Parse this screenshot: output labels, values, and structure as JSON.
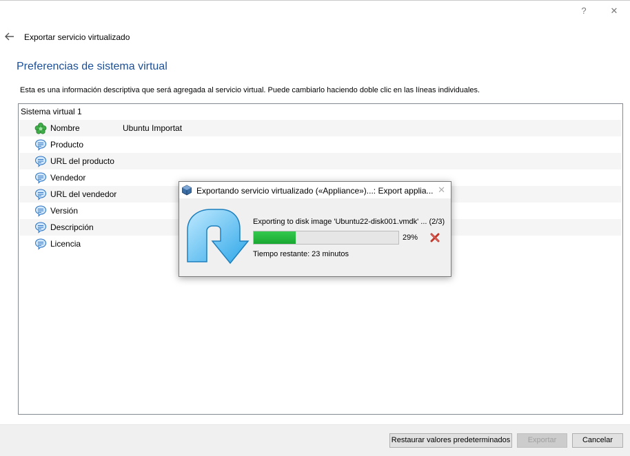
{
  "window": {
    "help_label": "?",
    "close_label": "✕"
  },
  "wizard": {
    "title": "Exportar servicio virtualizado",
    "heading": "Preferencias de sistema virtual",
    "description": "Esta es una información descriptiva que será agregada al servicio virtual. Puede cambiarlo haciendo doble clic en las líneas individuales."
  },
  "tree": {
    "root": "Sistema virtual 1",
    "rows": [
      {
        "label": "Nombre",
        "value": "Ubuntu Importat",
        "icon": "name-icon"
      },
      {
        "label": "Producto",
        "value": "",
        "icon": "description-icon"
      },
      {
        "label": "URL del producto",
        "value": "",
        "icon": "description-icon"
      },
      {
        "label": "Vendedor",
        "value": "",
        "icon": "description-icon"
      },
      {
        "label": "URL del vendedor",
        "value": "",
        "icon": "description-icon"
      },
      {
        "label": "Versión",
        "value": "",
        "icon": "description-icon"
      },
      {
        "label": "Descripción",
        "value": "",
        "icon": "description-icon"
      },
      {
        "label": "Licencia",
        "value": "",
        "icon": "description-icon"
      }
    ]
  },
  "buttons": {
    "restore": "Restaurar valores predeterminados",
    "export": "Exportar",
    "cancel": "Cancelar"
  },
  "progress_dialog": {
    "title": "Exportando servicio virtualizado («Appliance»)...: Export applia...",
    "close_label": "✕",
    "operation": "Exporting to disk image 'Ubuntu22-disk001.vmdk' ... (2/3)",
    "progress": 0.29,
    "percent_text": "29%",
    "remaining": "Tiempo restante: 23 minutos"
  },
  "colors": {
    "heading": "#1a4f99",
    "progress": "#18a831",
    "cancel_x": "#c0392b"
  }
}
